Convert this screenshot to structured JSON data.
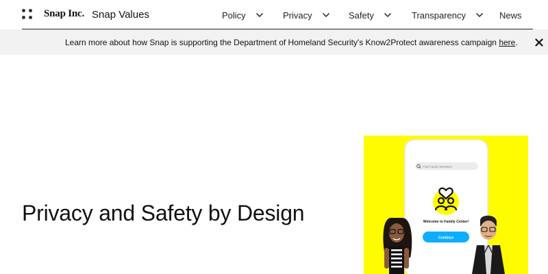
{
  "header": {
    "brand": "Snap Inc.",
    "site_title": "Snap Values",
    "nav": [
      {
        "label": "Policy",
        "has_dropdown": true
      },
      {
        "label": "Privacy",
        "has_dropdown": true
      },
      {
        "label": "Safety",
        "has_dropdown": true
      },
      {
        "label": "Transparency",
        "has_dropdown": true
      },
      {
        "label": "News",
        "has_dropdown": false
      }
    ],
    "icons": {
      "menu": "grid-dots-icon",
      "dropdown": "chevron-down-icon"
    }
  },
  "banner": {
    "text": "Learn more about how Snap is supporting the Department of Homeland Security's Know2Protect awareness campaign ",
    "link_label": "here",
    "suffix": ".",
    "close_icon": "close-icon"
  },
  "hero": {
    "title": "Privacy and Safety by Design",
    "image": {
      "search_placeholder": "Find Family Members",
      "welcome_text": "Welcome to Family Center!",
      "button_label": "Continue"
    }
  },
  "colors": {
    "snap_yellow": "#FFFC00",
    "button_blue": "#0FADFF",
    "banner_bg": "#F2F2F2",
    "text": "#111111"
  }
}
